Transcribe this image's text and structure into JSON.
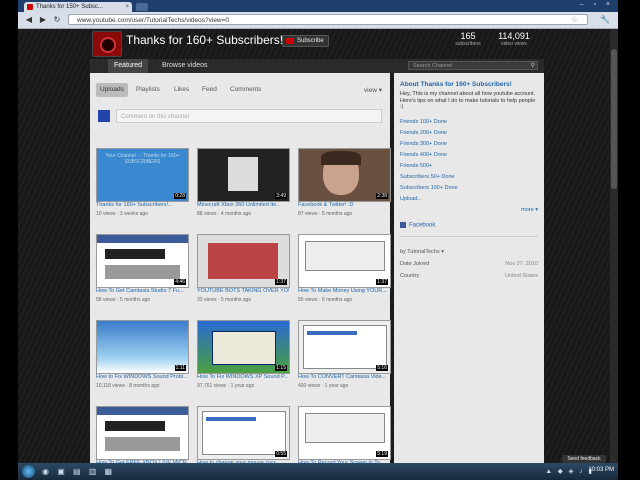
{
  "browser": {
    "tab_title": "Thanks for 150+ Subsc...",
    "tab_close": "×",
    "window_controls": "– ▫ ×",
    "back": "◀",
    "forward": "▶",
    "reload": "↻",
    "url": "www.youtube.com/user/TutorialTechs/videos?view=0",
    "star": "☆",
    "wrench": "🔧"
  },
  "channel": {
    "title": "Thanks for 160+ Subscribers!",
    "subscribe_label": "Subscribe",
    "stats": [
      {
        "value": "165",
        "label": "subscribers"
      },
      {
        "value": "114,091",
        "label": "video views"
      }
    ],
    "tabs": [
      {
        "label": "Featured",
        "active": true
      },
      {
        "label": "Browse videos",
        "active": false
      }
    ],
    "search_placeholder": "Search Channel",
    "search_icon": "magnifier-icon"
  },
  "feed": {
    "tabs": [
      "Uploads",
      "Playlists",
      "Likes",
      "Feed",
      "Comments"
    ],
    "view_label": "view ▾",
    "comment_placeholder": "Comment on this channel"
  },
  "videos": [
    {
      "title": "Thanks for 160+ Subscribers!...",
      "meta": "10 views · 3 weeks ago",
      "duration": "0:28",
      "thumb": "th-blue",
      "thumb_text": "Your Channel ··· Thanks for 160+ SUBSCRIBERS"
    },
    {
      "title": "Minecraft Xbox 360 Unlimited ite...",
      "meta": "88 views · 4 months ago",
      "duration": "3:49",
      "thumb": "th-dark",
      "thumb_text": ""
    },
    {
      "title": "Facebook & Twitter! :D",
      "meta": "87 views · 5 months ago",
      "duration": "2:38",
      "thumb": "th-face",
      "thumb_text": ""
    },
    {
      "title": "How To Get Camtasia Studio 7 Fu...",
      "meta": "58 views · 5 months ago",
      "duration": "4:46",
      "thumb": "th-web",
      "thumb_text": ""
    },
    {
      "title": "YOUTUBE BOTS TAKING OVER YOU...",
      "meta": "33 views · 5 months ago",
      "duration": "1:37",
      "thumb": "th-web2",
      "thumb_text": ""
    },
    {
      "title": "How To Make Money Using YOUR...",
      "meta": "55 views · 6 months ago",
      "duration": "1:37",
      "thumb": "th-web3",
      "thumb_text": ""
    },
    {
      "title": "How to Fix WINDOWS Sound Probl...",
      "meta": "10,118 views · 8 months ago",
      "duration": "1:11",
      "thumb": "th-sky",
      "thumb_text": ""
    },
    {
      "title": "How To Fix WINDOWS XP Sound P...",
      "meta": "97,761 views · 1 year ago",
      "duration": "1:15",
      "thumb": "th-xp",
      "thumb_text": ""
    },
    {
      "title": "How To CONVERT Camtasia Vide...",
      "meta": "400 views · 1 year ago",
      "duration": "5:16",
      "thumb": "th-doc",
      "thumb_text": ""
    },
    {
      "title": "How To Get FREE XBOX LIVE MICR...",
      "meta": "",
      "duration": "",
      "thumb": "th-web",
      "thumb_text": ""
    },
    {
      "title": "How to change your mouse curs...",
      "meta": "",
      "duration": "0:55",
      "thumb": "th-doc",
      "thumb_text": ""
    },
    {
      "title": "How To Record Your Screen in To...",
      "meta": "",
      "duration": "5:19",
      "thumb": "th-web3",
      "thumb_text": ""
    }
  ],
  "sidebar": {
    "heading": "About Thanks for 160+ Subscribers!",
    "description": "Hey, This is my channel about all how youtube account. Here's tips on what I do to make tutorials to help people :)",
    "goals": [
      "Friends 100+ Done",
      "Friends 200+ Done",
      "Friends 300+ Done",
      "Friends 400+ Done",
      "Friends 500+",
      "Subscribers 50+ Done",
      "Subscribers 100+ Done",
      "Upload..."
    ],
    "more_label": "more ▾",
    "facebook_label": "Facebook",
    "owner_label": "by TutorialTechs ▾",
    "date_joined_label": "Date Joined",
    "date_joined_value": "Nov 27, 2010",
    "country_label": "Country",
    "country_value": "United States"
  },
  "feedback_label": "Send feedback",
  "taskbar": {
    "icons": "◉ ▣ ▤ ▥ ▦",
    "tray": "▲ ◆ ◈ ♪ ▮",
    "time": "10:03 PM"
  }
}
